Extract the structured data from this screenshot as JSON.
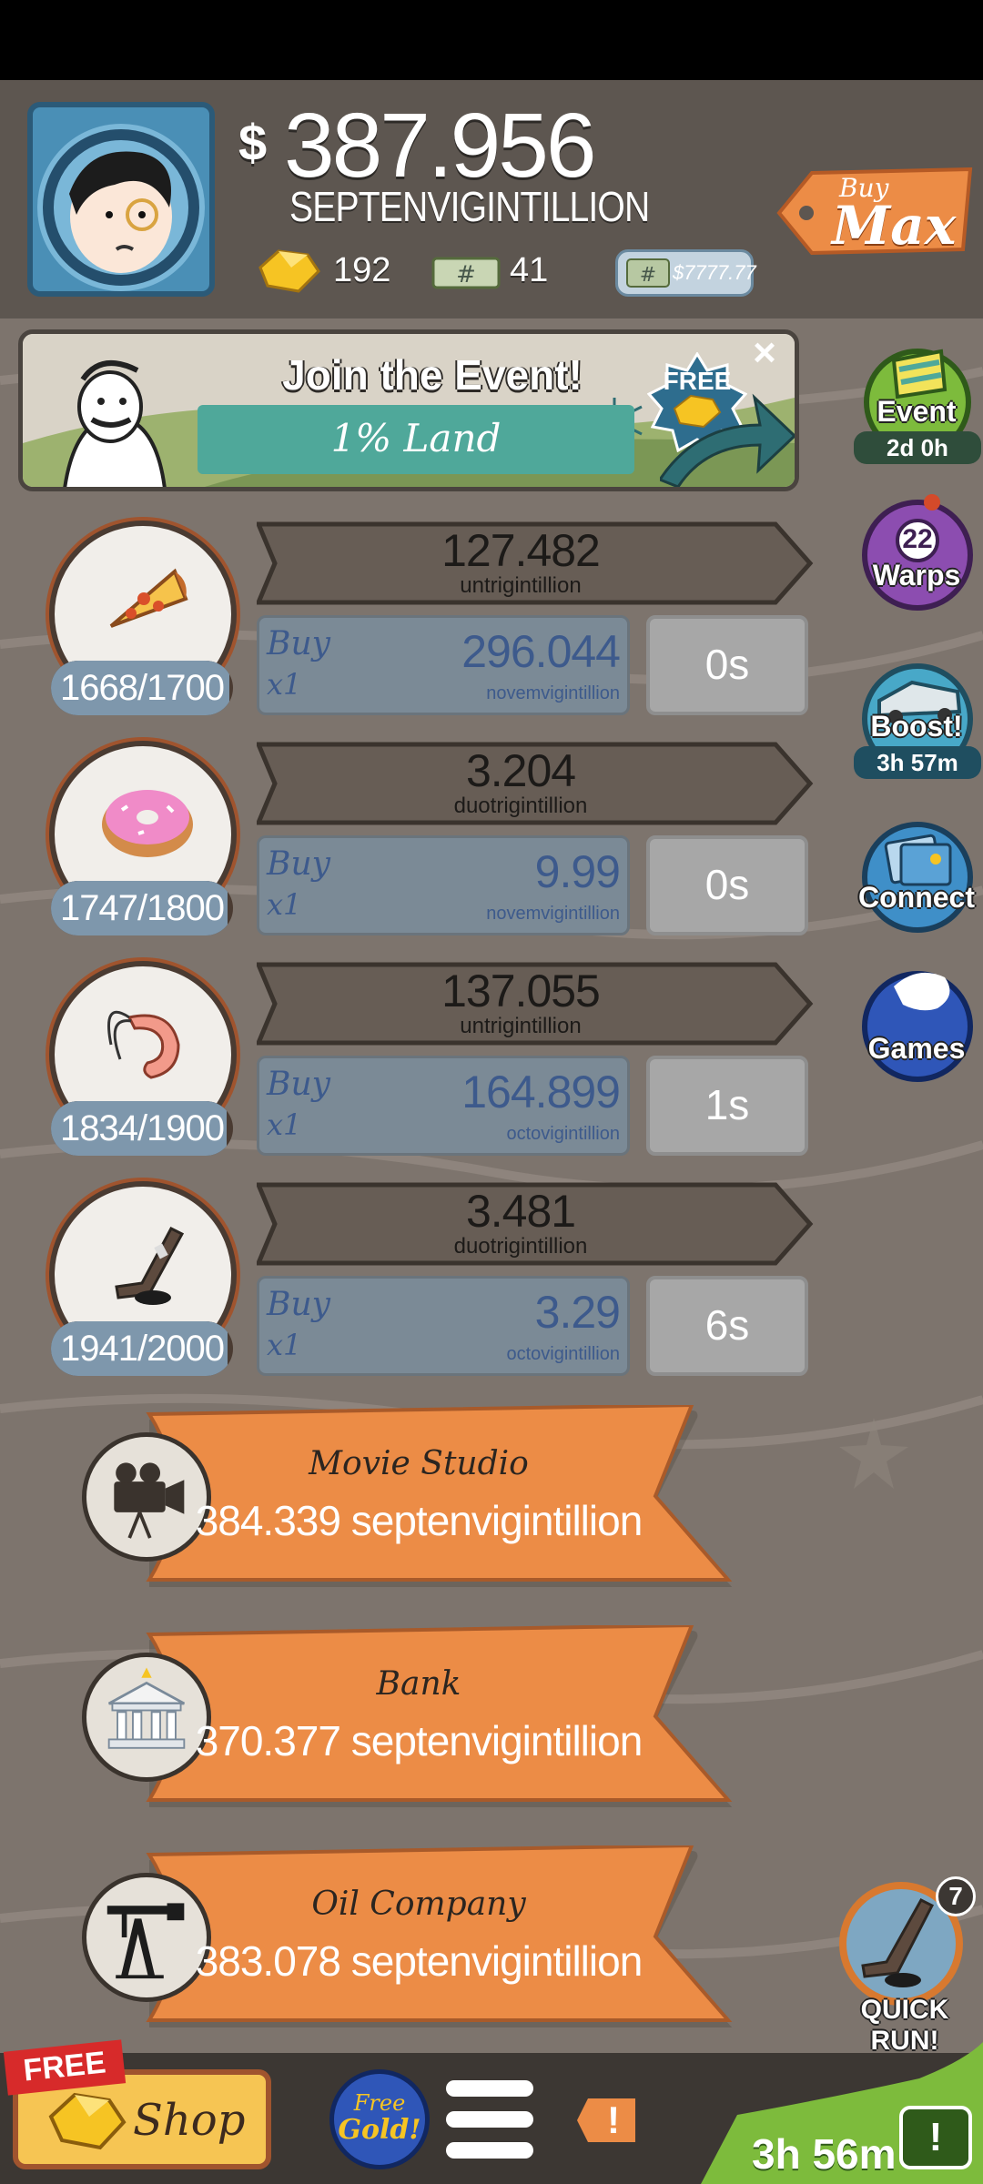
{
  "header": {
    "currency_symbol": "$",
    "money_value": "387.956",
    "money_unit": "SEPTENVIGINTILLION",
    "gold_count": "192",
    "megabucks_count": "41",
    "megaticket_value": "$7777.77",
    "buy_max_top": "Buy",
    "buy_max_bottom": "Max"
  },
  "event": {
    "title": "Join the Event!",
    "subtitle": "1% Land",
    "free_badge": "FREE"
  },
  "side": {
    "event_label": "Event",
    "event_time": "2d 0h",
    "warps_count": "22",
    "warps_label": "Warps",
    "boost_label": "Boost!",
    "boost_time": "3h 57m",
    "connect_label": "Connect",
    "games_label": "Games",
    "quickrun_label": "QUICK RUN!",
    "quickrun_count": "7"
  },
  "businesses": [
    {
      "level_done": "1668",
      "level_max": "1700",
      "fill": 0.98,
      "profit": "127.482",
      "profit_unit": "untrigintillion",
      "buy_label": "Buy",
      "multiplier": "x1",
      "price": "296.044",
      "price_unit": "novemvigintillion",
      "timer": "0s",
      "icon": "pizza-icon"
    },
    {
      "level_done": "1747",
      "level_max": "1800",
      "fill": 0.97,
      "profit": "3.204",
      "profit_unit": "duotrigintillion",
      "buy_label": "Buy",
      "multiplier": "x1",
      "price": "9.99",
      "price_unit": "novemvigintillion",
      "timer": "0s",
      "icon": "donut-icon"
    },
    {
      "level_done": "1834",
      "level_max": "1900",
      "fill": 0.965,
      "profit": "137.055",
      "profit_unit": "untrigintillion",
      "buy_label": "Buy",
      "multiplier": "x1",
      "price": "164.899",
      "price_unit": "octovigintillion",
      "timer": "1s",
      "icon": "shrimp-icon"
    },
    {
      "level_done": "1941",
      "level_max": "2000",
      "fill": 0.97,
      "profit": "3.481",
      "profit_unit": "duotrigintillion",
      "buy_label": "Buy",
      "multiplier": "x1",
      "price": "3.29",
      "price_unit": "octovigintillion",
      "timer": "6s",
      "icon": "hockey-icon"
    }
  ],
  "managers": [
    {
      "name": "Movie Studio",
      "price": "384.339 septenvigintillion",
      "icon": "movie-camera-icon"
    },
    {
      "name": "Bank",
      "price": "370.377 septenvigintillion",
      "icon": "bank-icon"
    },
    {
      "name": "Oil Company",
      "price": "383.078 septenvigintillion",
      "icon": "oil-rig-icon"
    }
  ],
  "bottom": {
    "free_ribbon": "FREE",
    "shop_label": "Shop",
    "free_gold_top": "Free",
    "free_gold_bottom": "Gold!",
    "alert_mark": "!",
    "timer": "3h 56m",
    "tv_mark": "!"
  },
  "colors": {
    "background": "#7d746d",
    "manager_orange": "#ec8c46",
    "profit_banner": "#675d55",
    "buy_blue": "#3d5a8c"
  }
}
